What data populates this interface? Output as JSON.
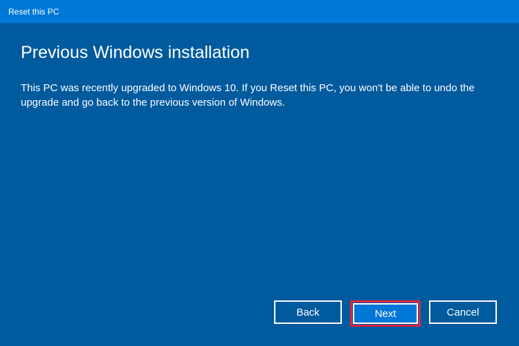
{
  "titlebar": {
    "title": "Reset this PC"
  },
  "main": {
    "heading": "Previous Windows installation",
    "description": "This PC was recently upgraded to Windows 10. If you Reset this PC, you won't be able to undo the upgrade and go back to the previous version of Windows."
  },
  "buttons": {
    "back": "Back",
    "next": "Next",
    "cancel": "Cancel"
  }
}
